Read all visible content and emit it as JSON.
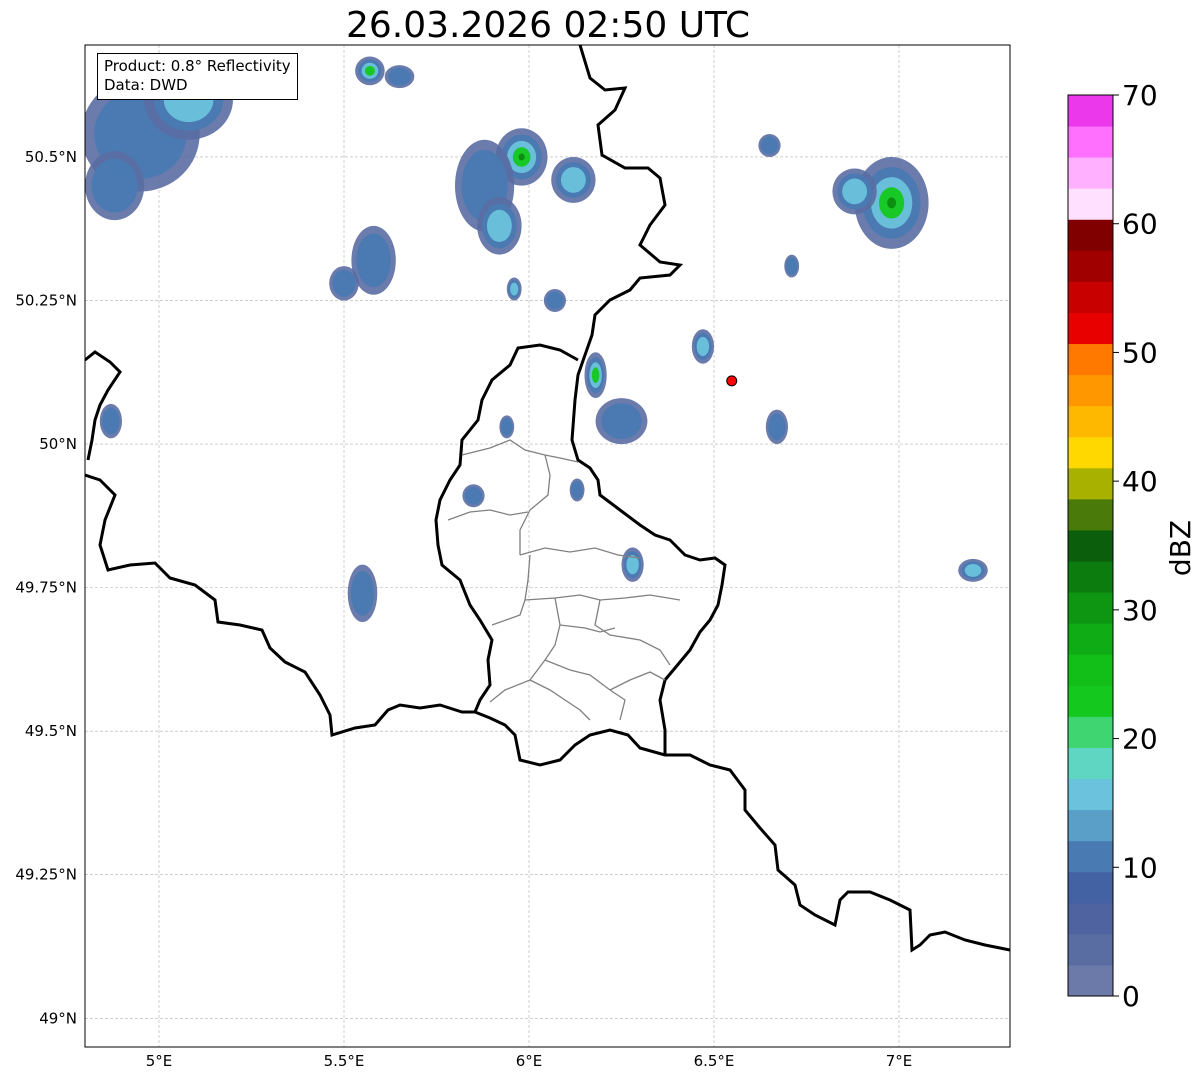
{
  "title": "26.03.2026 02:50 UTC",
  "info": {
    "product": "Product: 0.8° Reflectivity",
    "source": "Data: DWD"
  },
  "map": {
    "lon_range": [
      4.8,
      7.3
    ],
    "lat_range": [
      48.95,
      50.695
    ],
    "lon_ticks": [
      {
        "value": 5.0,
        "label": "5°E"
      },
      {
        "value": 5.5,
        "label": "5.5°E"
      },
      {
        "value": 6.0,
        "label": "6°E"
      },
      {
        "value": 6.5,
        "label": "6.5°E"
      },
      {
        "value": 7.0,
        "label": "7°E"
      }
    ],
    "lat_ticks": [
      {
        "value": 50.5,
        "label": "50.5°N"
      },
      {
        "value": 50.25,
        "label": "50.25°N"
      },
      {
        "value": 50.0,
        "label": "50°N"
      },
      {
        "value": 49.75,
        "label": "49.75°N"
      },
      {
        "value": 49.5,
        "label": "49.5°N"
      },
      {
        "value": 49.25,
        "label": "49.25°N"
      },
      {
        "value": 49.0,
        "label": "49°N"
      }
    ],
    "radar_site": {
      "lon": 6.548,
      "lat": 50.11,
      "color": "#ff0000"
    },
    "echoes": [
      {
        "lon": 4.95,
        "lat": 50.54,
        "rx": 0.16,
        "ry": 0.1,
        "level": 1
      },
      {
        "lon": 5.08,
        "lat": 50.6,
        "rx": 0.12,
        "ry": 0.07,
        "level": 2
      },
      {
        "lon": 4.88,
        "lat": 50.45,
        "rx": 0.08,
        "ry": 0.06,
        "level": 1
      },
      {
        "lon": 5.57,
        "lat": 50.65,
        "rx": 0.04,
        "ry": 0.025,
        "level": 3
      },
      {
        "lon": 5.65,
        "lat": 50.64,
        "rx": 0.04,
        "ry": 0.02,
        "level": 1
      },
      {
        "lon": 5.98,
        "lat": 50.5,
        "rx": 0.07,
        "ry": 0.05,
        "level": 4
      },
      {
        "lon": 5.88,
        "lat": 50.45,
        "rx": 0.08,
        "ry": 0.08,
        "level": 1
      },
      {
        "lon": 5.92,
        "lat": 50.38,
        "rx": 0.06,
        "ry": 0.05,
        "level": 2
      },
      {
        "lon": 6.12,
        "lat": 50.46,
        "rx": 0.06,
        "ry": 0.04,
        "level": 2
      },
      {
        "lon": 5.58,
        "lat": 50.32,
        "rx": 0.06,
        "ry": 0.06,
        "level": 1
      },
      {
        "lon": 5.5,
        "lat": 50.28,
        "rx": 0.04,
        "ry": 0.03,
        "level": 1
      },
      {
        "lon": 5.96,
        "lat": 50.27,
        "rx": 0.02,
        "ry": 0.02,
        "level": 2
      },
      {
        "lon": 6.07,
        "lat": 50.25,
        "rx": 0.03,
        "ry": 0.02,
        "level": 1
      },
      {
        "lon": 6.98,
        "lat": 50.42,
        "rx": 0.1,
        "ry": 0.08,
        "level": 4
      },
      {
        "lon": 6.88,
        "lat": 50.44,
        "rx": 0.06,
        "ry": 0.04,
        "level": 2
      },
      {
        "lon": 6.65,
        "lat": 50.52,
        "rx": 0.03,
        "ry": 0.02,
        "level": 1
      },
      {
        "lon": 6.71,
        "lat": 50.31,
        "rx": 0.02,
        "ry": 0.02,
        "level": 1
      },
      {
        "lon": 6.47,
        "lat": 50.17,
        "rx": 0.03,
        "ry": 0.03,
        "level": 2
      },
      {
        "lon": 6.18,
        "lat": 50.12,
        "rx": 0.03,
        "ry": 0.04,
        "level": 3
      },
      {
        "lon": 6.25,
        "lat": 50.04,
        "rx": 0.07,
        "ry": 0.04,
        "level": 1
      },
      {
        "lon": 6.67,
        "lat": 50.03,
        "rx": 0.03,
        "ry": 0.03,
        "level": 1
      },
      {
        "lon": 5.94,
        "lat": 50.03,
        "rx": 0.02,
        "ry": 0.02,
        "level": 1
      },
      {
        "lon": 5.55,
        "lat": 49.74,
        "rx": 0.04,
        "ry": 0.05,
        "level": 1
      },
      {
        "lon": 6.28,
        "lat": 49.79,
        "rx": 0.03,
        "ry": 0.03,
        "level": 2
      },
      {
        "lon": 7.2,
        "lat": 49.78,
        "rx": 0.04,
        "ry": 0.02,
        "level": 2
      },
      {
        "lon": 4.87,
        "lat": 50.04,
        "rx": 0.03,
        "ry": 0.03,
        "level": 1
      },
      {
        "lon": 6.13,
        "lat": 49.92,
        "rx": 0.02,
        "ry": 0.02,
        "level": 1
      },
      {
        "lon": 5.85,
        "lat": 49.91,
        "rx": 0.03,
        "ry": 0.02,
        "level": 1
      }
    ]
  },
  "colorbar": {
    "unit": "dBZ",
    "min": 0,
    "max": 70,
    "tick_labels": [
      "0",
      "10",
      "20",
      "30",
      "40",
      "50",
      "60",
      "70"
    ],
    "colors": [
      "#6b7aa8",
      "#5a6da3",
      "#4e63a0",
      "#4262a4",
      "#4a7ab2",
      "#5a9fc8",
      "#6ac2dc",
      "#5fd6c2",
      "#3fd672",
      "#14c81e",
      "#12be18",
      "#10ac16",
      "#0e9612",
      "#0c7c0e",
      "#0b5e0b",
      "#4a7a0a",
      "#a8b000",
      "#ffd800",
      "#ffb800",
      "#ff9800",
      "#ff7800",
      "#e80000",
      "#c80000",
      "#a00000",
      "#800000",
      "#ffe0ff",
      "#ffb0ff",
      "#ff70ff",
      "#ea38ea"
    ]
  }
}
